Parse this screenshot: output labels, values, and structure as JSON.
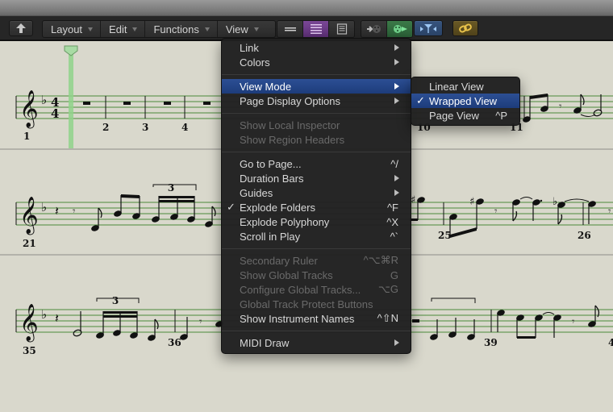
{
  "toolbar": {
    "back_icon": "up-arrow-icon",
    "menus": [
      {
        "label": "Layout"
      },
      {
        "label": "Edit"
      },
      {
        "label": "Functions"
      },
      {
        "label": "View"
      }
    ],
    "view_buttons": [
      {
        "icon": "linear-view-icon",
        "active": false
      },
      {
        "icon": "wrapped-view-icon",
        "active": true
      },
      {
        "icon": "page-view-icon",
        "active": false
      }
    ],
    "catch_buttons": [
      {
        "icon": "midi-in-icon",
        "active": false
      },
      {
        "icon": "midi-out-icon",
        "active": true
      }
    ],
    "filter_icon": "filter-icon",
    "link_icon": "link-icon",
    "colors": {
      "purple_active": "#6b3a86",
      "green_active": "#2f6a3c",
      "blue": "#2f4f78",
      "gold": "#6b5a22"
    }
  },
  "view_menu": {
    "items": [
      {
        "label": "Link",
        "submenu": true
      },
      {
        "label": "Colors",
        "submenu": true
      },
      {
        "separator": true
      },
      {
        "label": "View Mode",
        "submenu": true,
        "selected": true
      },
      {
        "label": "Page Display Options",
        "submenu": true
      },
      {
        "separator": true
      },
      {
        "label": "Show Local Inspector",
        "disabled": true
      },
      {
        "label": "Show Region Headers",
        "disabled": true
      },
      {
        "separator": true
      },
      {
        "label": "Go to Page...",
        "shortcut": "^/"
      },
      {
        "label": "Duration Bars",
        "submenu": true
      },
      {
        "label": "Guides",
        "submenu": true
      },
      {
        "label": "Explode Folders",
        "shortcut": "^F",
        "checked": true
      },
      {
        "label": "Explode Polyphony",
        "shortcut": "^X"
      },
      {
        "label": "Scroll in Play",
        "shortcut": "^`"
      },
      {
        "separator": true
      },
      {
        "label": "Secondary Ruler",
        "shortcut": "^⌥⌘R",
        "disabled": true
      },
      {
        "label": "Show Global Tracks",
        "shortcut": "G",
        "disabled": true
      },
      {
        "label": "Configure Global Tracks...",
        "shortcut": "⌥G",
        "disabled": true
      },
      {
        "label": "Global Track Protect Buttons",
        "disabled": true
      },
      {
        "label": "Show Instrument Names",
        "shortcut": "^⇧N"
      },
      {
        "separator": true
      },
      {
        "label": "MIDI Draw",
        "submenu": true
      }
    ]
  },
  "view_mode_submenu": {
    "items": [
      {
        "label": "Linear View"
      },
      {
        "label": "Wrapped View",
        "checked": true,
        "selected": true
      },
      {
        "label": "Page View",
        "shortcut": "^P"
      }
    ]
  },
  "score": {
    "staff_color": "#3f7d2f",
    "playhead_color": "#8fd48a",
    "key_signature": "♭",
    "time_signature": {
      "top": "4",
      "bottom": "4"
    },
    "tuplet_label": "3",
    "rows": [
      {
        "bar_numbers": [
          "1",
          "2",
          "3",
          "4",
          "10",
          "11"
        ]
      },
      {
        "bar_numbers": [
          "21",
          "25",
          "26"
        ]
      },
      {
        "bar_numbers": [
          "35",
          "36",
          "39",
          "4"
        ]
      }
    ]
  }
}
